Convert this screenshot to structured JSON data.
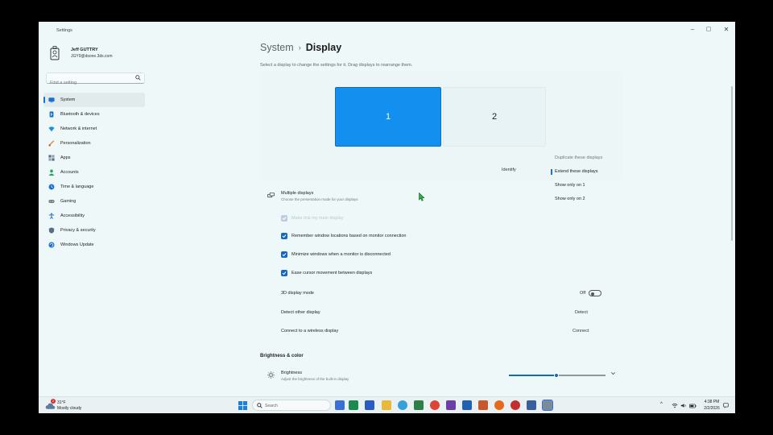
{
  "window": {
    "title": "Settings",
    "minimize": "–",
    "maximize": "▢",
    "close": "✕"
  },
  "profile": {
    "name": "Jeff GUTTRY",
    "email": "JGY9@dsone.3ds.com"
  },
  "search": {
    "placeholder": "Find a setting"
  },
  "sidebar": {
    "items": [
      {
        "label": "System",
        "icon": "system-icon",
        "color": "#1a6fcf",
        "active": true
      },
      {
        "label": "Bluetooth & devices",
        "icon": "bluetooth-icon",
        "color": "#1a6fcf"
      },
      {
        "label": "Network & internet",
        "icon": "wifi-icon",
        "color": "#1a8fe0"
      },
      {
        "label": "Personalization",
        "icon": "brush-icon",
        "color": "#e07b2c"
      },
      {
        "label": "Apps",
        "icon": "apps-icon",
        "color": "#5a6f80"
      },
      {
        "label": "Accounts",
        "icon": "person-icon",
        "color": "#2aa05a"
      },
      {
        "label": "Time & language",
        "icon": "globe-clock-icon",
        "color": "#1a6fcf"
      },
      {
        "label": "Gaming",
        "icon": "gamepad-icon",
        "color": "#6c7a86"
      },
      {
        "label": "Accessibility",
        "icon": "accessibility-icon",
        "color": "#1a6fcf"
      },
      {
        "label": "Privacy & security",
        "icon": "shield-icon",
        "color": "#5a6f80"
      },
      {
        "label": "Windows Update",
        "icon": "update-icon",
        "color": "#1a6fcf"
      }
    ]
  },
  "breadcrumb": {
    "parent": "System",
    "separator": "›",
    "current": "Display"
  },
  "subtitle": "Select a display to change the settings for it. Drag displays to rearrange them.",
  "monitors": {
    "primary": "1",
    "secondary": "2"
  },
  "identify": "Identify",
  "mode_menu": [
    {
      "label": "Duplicate these displays",
      "muted": true
    },
    {
      "label": "Extend these displays",
      "selected": true
    },
    {
      "label": "Show only on 1"
    },
    {
      "label": "Show only on 2"
    }
  ],
  "multiple_displays": {
    "title": "Multiple displays",
    "desc": "Choose the presentation mode for your displays"
  },
  "checkboxes": [
    {
      "label": "Make this my main display",
      "checked": true,
      "disabled": true
    },
    {
      "label": "Remember window locations based on monitor connection",
      "checked": true
    },
    {
      "label": "Minimize windows when a monitor is disconnected",
      "checked": true
    },
    {
      "label": "Ease cursor movement between displays",
      "checked": true
    }
  ],
  "display_3d": {
    "label": "3D display mode",
    "state": "Off"
  },
  "detect": {
    "label": "Detect other display",
    "button": "Detect"
  },
  "wireless": {
    "label": "Connect to a wireless display",
    "button": "Connect"
  },
  "brightness_section": "Brightness & color",
  "brightness": {
    "title": "Brightness",
    "desc": "Adjust the brightness of the built-in display",
    "level": 0.49
  },
  "taskbar": {
    "weather": {
      "temp": "31°F",
      "desc": "Mostly cloudy",
      "badge": "2"
    },
    "search_placeholder": "Search",
    "tray_chevron": "^",
    "clock": {
      "time": "4:38 PM",
      "date": "2/2/2026"
    }
  },
  "colors": {
    "accent": "#1467c4",
    "monitor_selected": "#138ff0",
    "background": "#eff8f9"
  }
}
